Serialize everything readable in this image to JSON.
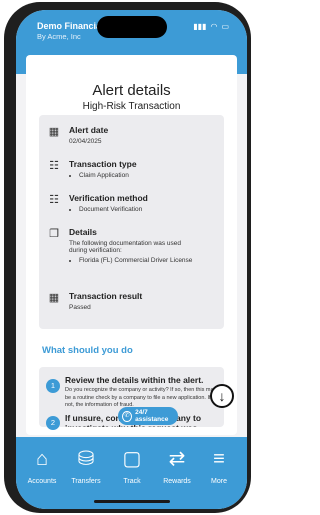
{
  "app": {
    "name": "Demo Financial",
    "subtitle": "By Acme, Inc"
  },
  "status": {
    "signal": "▮▮▮",
    "wifi": "◠",
    "battery": "▭"
  },
  "dialog": {
    "title": "Alert details",
    "subtitle": "High-Risk Transaction",
    "close_icon": "×",
    "fields": [
      {
        "label": "Alert date",
        "value": "02/04/2025",
        "icon": "calendar-icon"
      },
      {
        "label": "Transaction type",
        "bullets": [
          "Claim Application"
        ],
        "icon": "list-icon"
      },
      {
        "label": "Verification method",
        "bullets": [
          "Document Verification"
        ],
        "icon": "list-icon"
      },
      {
        "label": "Details",
        "value": "The following documentation was used during verification:",
        "bullets": [
          "Florida (FL) Commercial Driver License"
        ],
        "icon": "book-icon"
      },
      {
        "label": "Transaction result",
        "value": "Passed",
        "icon": "calendar-icon"
      }
    ],
    "what_heading": "What should you do",
    "steps": [
      {
        "num": "1",
        "title": "Review the details within the alert.",
        "body": "Do you recognize the company or activity? If so, then this may be a routine check by a company to file a new application. If not,    the information of fraud."
      },
      {
        "num": "2",
        "title": "If unsure, contact the company to investigate why this request was"
      }
    ],
    "assist_label": "24/7 assistance"
  },
  "nav": [
    {
      "label": "Accounts",
      "icon": "home-icon"
    },
    {
      "label": "Transfers",
      "icon": "transfers-icon"
    },
    {
      "label": "Track",
      "icon": "chat-icon"
    },
    {
      "label": "Rewards",
      "icon": "rewards-icon"
    },
    {
      "label": "More",
      "icon": "menu-icon"
    }
  ],
  "colors": {
    "brand": "#3d9bd6"
  }
}
